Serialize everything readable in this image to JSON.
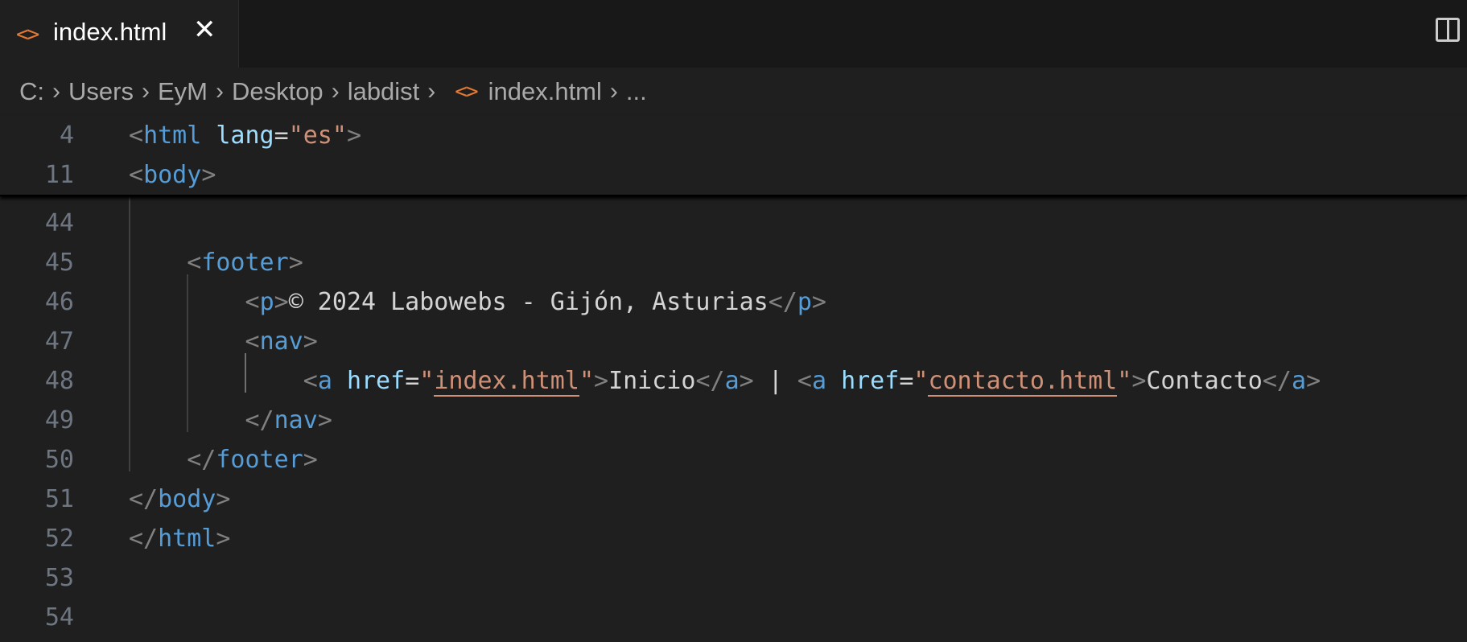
{
  "tab": {
    "label": "index.html",
    "icon": "code-icon",
    "close": "✕"
  },
  "breadcrumb": {
    "items": [
      "C:",
      "Users",
      "EyM",
      "Desktop",
      "labdist"
    ],
    "file": "index.html",
    "more": "...",
    "separator": "›"
  },
  "sticky": [
    {
      "num": "4",
      "tokens": [
        [
          "br",
          "<"
        ],
        [
          "tag",
          "html"
        ],
        [
          "txt",
          " "
        ],
        [
          "attr",
          "lang"
        ],
        [
          "txt",
          "="
        ],
        [
          "str",
          "\"es\""
        ],
        [
          "br",
          ">"
        ]
      ]
    },
    {
      "num": "11",
      "tokens": [
        [
          "br",
          "<"
        ],
        [
          "tag",
          "body"
        ],
        [
          "br",
          ">"
        ]
      ]
    }
  ],
  "lines": [
    {
      "num": "44",
      "tokens": []
    },
    {
      "num": "45",
      "tokens": [
        [
          "txt",
          "    "
        ],
        [
          "br",
          "<"
        ],
        [
          "tag",
          "footer"
        ],
        [
          "br",
          ">"
        ]
      ]
    },
    {
      "num": "46",
      "tokens": [
        [
          "txt",
          "        "
        ],
        [
          "br",
          "<"
        ],
        [
          "tag",
          "p"
        ],
        [
          "br",
          ">"
        ],
        [
          "txt",
          "© 2024 Labowebs - Gijón, Asturias"
        ],
        [
          "br",
          "</"
        ],
        [
          "tag",
          "p"
        ],
        [
          "br",
          ">"
        ]
      ]
    },
    {
      "num": "47",
      "tokens": [
        [
          "txt",
          "        "
        ],
        [
          "br",
          "<"
        ],
        [
          "tag",
          "nav"
        ],
        [
          "br",
          ">"
        ]
      ]
    },
    {
      "num": "48",
      "tokens": [
        [
          "txt",
          "            "
        ],
        [
          "br",
          "<"
        ],
        [
          "tag",
          "a"
        ],
        [
          "txt",
          " "
        ],
        [
          "attr",
          "href"
        ],
        [
          "txt",
          "="
        ],
        [
          "str",
          "\""
        ],
        [
          "link",
          "index.html"
        ],
        [
          "str",
          "\""
        ],
        [
          "br",
          ">"
        ],
        [
          "txt",
          "Inicio"
        ],
        [
          "br",
          "</"
        ],
        [
          "tag",
          "a"
        ],
        [
          "br",
          ">"
        ],
        [
          "txt",
          " | "
        ],
        [
          "br",
          "<"
        ],
        [
          "tag",
          "a"
        ],
        [
          "txt",
          " "
        ],
        [
          "attr",
          "href"
        ],
        [
          "txt",
          "="
        ],
        [
          "str",
          "\""
        ],
        [
          "link",
          "contacto.html"
        ],
        [
          "str",
          "\""
        ],
        [
          "br",
          ">"
        ],
        [
          "txt",
          "Contacto"
        ],
        [
          "br",
          "</"
        ],
        [
          "tag",
          "a"
        ],
        [
          "br",
          ">"
        ]
      ]
    },
    {
      "num": "49",
      "tokens": [
        [
          "txt",
          "        "
        ],
        [
          "br",
          "</"
        ],
        [
          "tag",
          "nav"
        ],
        [
          "br",
          ">"
        ]
      ]
    },
    {
      "num": "50",
      "tokens": [
        [
          "txt",
          "    "
        ],
        [
          "br",
          "</"
        ],
        [
          "tag",
          "footer"
        ],
        [
          "br",
          ">"
        ]
      ]
    },
    {
      "num": "51",
      "tokens": [
        [
          "br",
          "</"
        ],
        [
          "tag",
          "body"
        ],
        [
          "br",
          ">"
        ]
      ]
    },
    {
      "num": "52",
      "tokens": [
        [
          "br",
          "</"
        ],
        [
          "tag",
          "html"
        ],
        [
          "br",
          ">"
        ]
      ]
    },
    {
      "num": "53",
      "tokens": []
    },
    {
      "num": "54",
      "tokens": []
    }
  ]
}
